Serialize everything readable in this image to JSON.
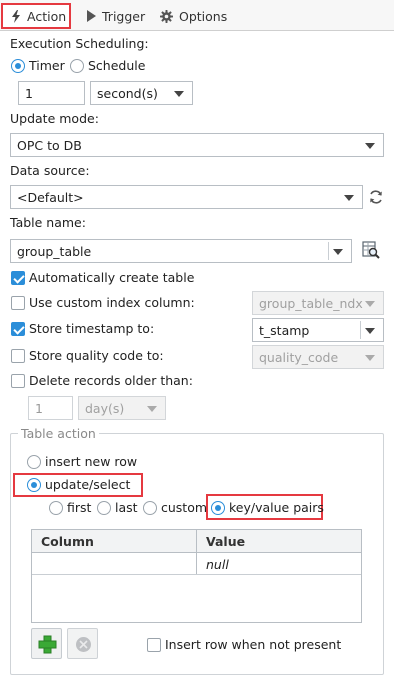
{
  "tabs": {
    "action": "Action",
    "trigger": "Trigger",
    "options": "Options"
  },
  "scheduling": {
    "label": "Execution Scheduling:",
    "timer": "Timer",
    "schedule": "Schedule",
    "interval_value": "1",
    "interval_unit": "second(s)"
  },
  "update_mode": {
    "label": "Update mode:",
    "value": "OPC to DB"
  },
  "data_source": {
    "label": "Data source:",
    "value": "<Default>"
  },
  "table_name": {
    "label": "Table name:",
    "value": "group_table"
  },
  "options": {
    "auto_create": "Automatically create table",
    "custom_index": "Use custom index column:",
    "custom_index_value": "group_table_ndx",
    "store_timestamp": "Store timestamp to:",
    "timestamp_value": "t_stamp",
    "store_quality": "Store quality code to:",
    "quality_value": "quality_code",
    "delete_older": "Delete records older than:",
    "delete_value": "1",
    "delete_unit": "day(s)"
  },
  "table_action": {
    "legend": "Table action",
    "insert_new_row": "insert new row",
    "update_select": "update/select",
    "first": "first",
    "last": "last",
    "custom": "custom",
    "key_value_pairs": "key/value pairs",
    "columns": [
      "Column",
      "Value"
    ],
    "rows": [
      {
        "column": "",
        "value": "null"
      }
    ],
    "insert_when_not_present": "Insert row when not present"
  },
  "icons": {
    "action": "lightning-icon",
    "trigger": "play-icon",
    "options": "gear-icon",
    "refresh": "refresh-icon",
    "browse": "table-search-icon",
    "add": "plus-icon",
    "remove": "remove-icon"
  },
  "colors": {
    "accent": "#2b8ed9",
    "highlight": "#e53940",
    "add_green": "#3aa935"
  }
}
